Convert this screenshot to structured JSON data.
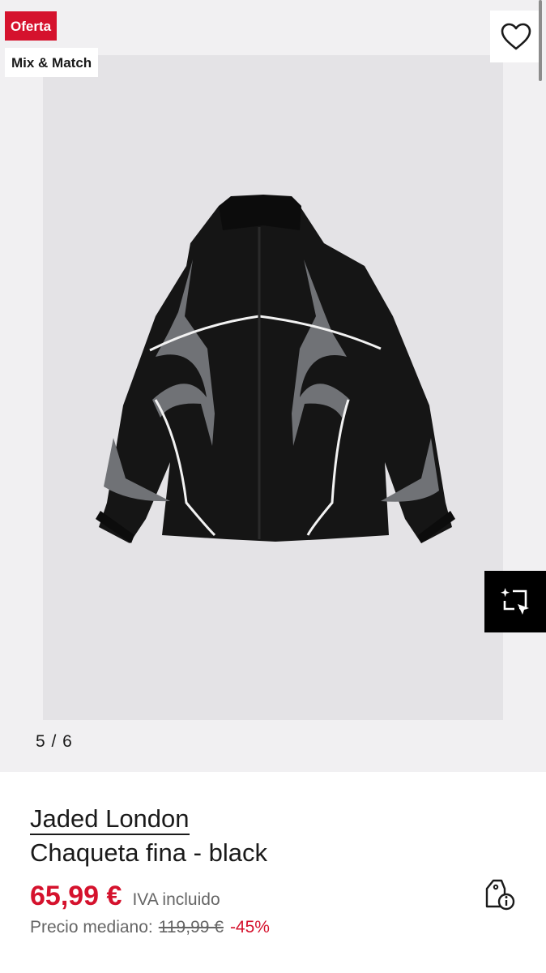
{
  "badges": {
    "offer": "Oferta",
    "collection": "Mix & Match"
  },
  "gallery": {
    "counter": "5 / 6",
    "icons": {
      "wishlist": "heart-outline-icon",
      "visual_search": "sparkle-scan-icon"
    }
  },
  "product": {
    "brand": "Jaded London",
    "name": "Chaqueta fina - black",
    "color": "black",
    "price": "65,99 €",
    "vat_note": "IVA incluido",
    "reference_label": "Precio mediano:",
    "reference_price": "119,99 €",
    "discount": "-45%",
    "price_info_icon": "price-tag-info-icon"
  },
  "colors": {
    "sale_red": "#d5122d",
    "text": "#1a1a1a",
    "muted": "#666666",
    "gallery_bg": "#f1f0f2"
  }
}
